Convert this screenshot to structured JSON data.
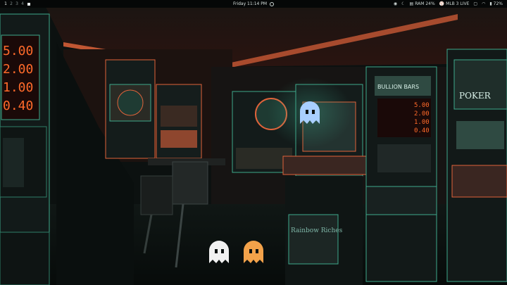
{
  "topbar": {
    "workspaces": [
      "1",
      "2",
      "3",
      "4"
    ],
    "active_workspace": "1",
    "clock": "Friday 11:14 PM",
    "tray": {
      "ram": "RAM 24%",
      "game": "MLB 3 LIVE",
      "battery": "72%"
    }
  },
  "icons": {
    "reddit": "reddit-icon",
    "moon": "moon-icon",
    "memory": "memory-icon",
    "baseball": "baseball-icon",
    "wifi": "wifi-icon",
    "battery": "battery-icon"
  },
  "scene_text": {
    "left_display": [
      "5.00",
      "2.00",
      "1.00",
      "0.40"
    ],
    "bullion_display": [
      "5.00",
      "2.00",
      "1.00",
      "0.40"
    ],
    "bullion_title": "BULLION BARS",
    "rainbow_title": "Rainbow Riches",
    "poker_title": "POKER"
  },
  "colors": {
    "accent_orange": "#e0633a",
    "accent_green": "#3ea98b",
    "ghost_blue": "#a9cfff",
    "ghost_white": "#f1f1f1",
    "ghost_orange": "#f3a24a"
  }
}
